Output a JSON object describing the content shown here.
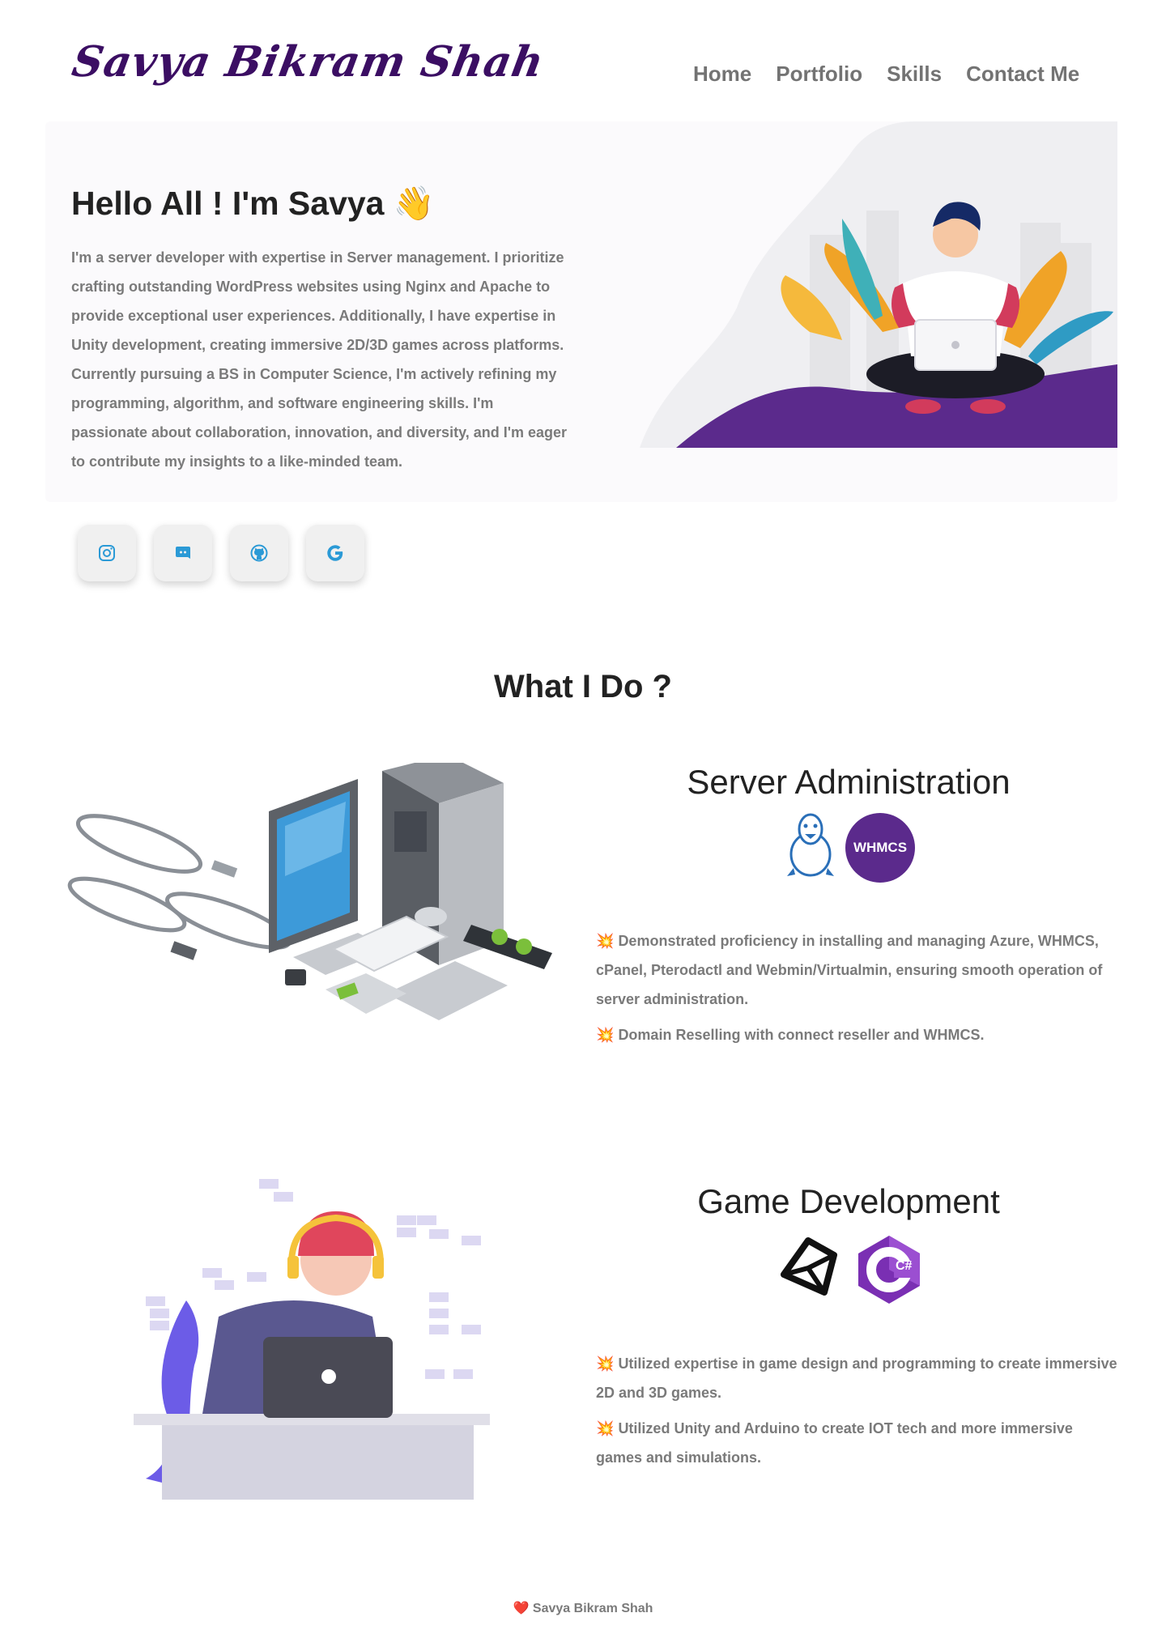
{
  "header": {
    "logo": "Savya Bikram Shah",
    "nav": [
      "Home",
      "Portfolio",
      "Skills",
      "Contact Me"
    ]
  },
  "hero": {
    "greeting": "Hello All ! I'm Savya",
    "wave_emoji": "👋",
    "bio": "I'm a server developer with expertise in Server management. I prioritize crafting outstanding WordPress websites using Nginx and Apache to provide exceptional user experiences. Additionally, I have expertise in Unity development, creating immersive 2D/3D games across platforms. Currently pursuing a BS in Computer Science, I'm actively refining my programming, algorithm, and software engineering skills. I'm passionate about collaboration, innovation, and diversity, and I'm eager to contribute my insights to a like-minded team.",
    "socials": [
      "instagram-icon",
      "discord-icon",
      "github-icon",
      "google-icon"
    ]
  },
  "what_i_do": {
    "title": "What I Do ?",
    "server": {
      "title": "Server Administration",
      "badge_whmcs": "WHMCS",
      "bullet_icon": "💥",
      "bullets": [
        "Demonstrated proficiency in installing and managing Azure, WHMCS, cPanel, Pterodactl and Webmin/Virtualmin, ensuring smooth operation of server administration.",
        "Domain Reselling with connect reseller and WHMCS."
      ]
    },
    "game": {
      "title": "Game Development",
      "badge_csharp": "C#",
      "bullets": [
        "Utilized expertise in game design and programming to create immersive 2D and 3D games.",
        "Utilized Unity and Arduino to create IOT tech and more immersive games and simulations."
      ]
    }
  },
  "footer": {
    "heart": "❤️",
    "text": "Savya Bikram Shah"
  },
  "colors": {
    "brand_purple": "#3b0e63",
    "nav_gray": "#737373",
    "text_gray": "#7a7a7a",
    "accent_purple": "#5b2a8c"
  }
}
